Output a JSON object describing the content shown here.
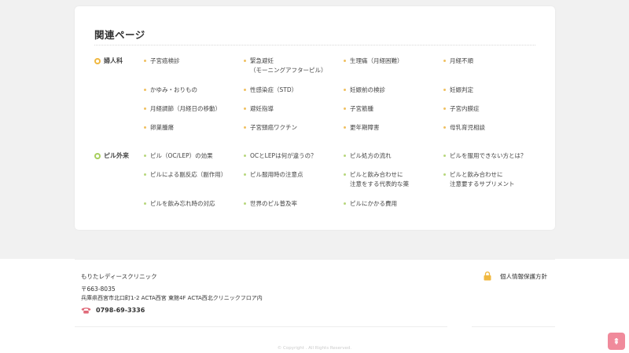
{
  "related": {
    "title": "関連ページ",
    "categories": [
      {
        "label": "婦人科",
        "color": "#f0b840",
        "links": [
          "子宮癌検診",
          "緊急避妊\n（モーニングアフターピル）",
          "生理痛（月経困難）",
          "月経不順",
          "かゆみ・おりもの",
          "性感染症（STD）",
          "妊娠前の検診",
          "妊娠判定",
          "月経調節（月経日の移動）",
          "避妊指導",
          "子宮筋腫",
          "子宮内膜症",
          "卵巣腫瘍",
          "子宮頸癌ワクチン",
          "更年期障害",
          "母乳育児相談"
        ]
      },
      {
        "label": "ピル外来",
        "color": "#a8cf5e",
        "links": [
          "ピル（OC/LEP）の効果",
          "OCとLEPは何が違うの？",
          "ピル処方の流れ",
          "ピルを服用できない方とは？",
          "ピルによる副反応（副作用）",
          "ピル服用時の注意点",
          "ピルと飲み合わせに\n注意をする代表的な薬",
          "ピルと飲み合わせに\n注意要するサプリメント",
          "ピルを飲み忘れ時の対応",
          "世界のピル普及率",
          "ピルにかかる費用"
        ]
      }
    ]
  },
  "footer": {
    "clinic_name": "もりたレディースクリニック",
    "zip": "〒663-8035",
    "address": "兵庫県西宮市北口町1-2 ACTA西宮 東館4F ACTA西北クリニックフロア内",
    "phone": "0798-69-3336",
    "privacy_label": "個人情報保護方針",
    "copyright": "© Copyright . All Rights Reserved."
  },
  "top_button": {
    "label": "⇞",
    "color": "#f08a9b"
  },
  "icons": {
    "phone": "phone-icon",
    "privacy": "lock-icon"
  }
}
